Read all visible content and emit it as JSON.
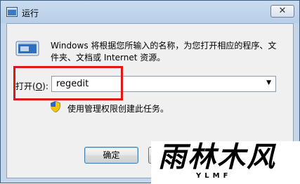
{
  "window": {
    "title": "运行",
    "close_label": "✕"
  },
  "run": {
    "description": "Windows 将根据您所输入的名称，为您打开相应的程序、文件夹、文档或 Internet 资源。",
    "open_label_prefix": "打开(",
    "open_label_key": "O",
    "open_label_suffix": "):",
    "command_value": "regedit",
    "admin_note": "使用管理权限创建此任务。"
  },
  "buttons": {
    "ok_label": "确定"
  },
  "watermark": {
    "brand": "雨林木风",
    "sub": "YLMF"
  },
  "colors": {
    "highlight": "#e01717",
    "frame": "#c4d6ea"
  }
}
